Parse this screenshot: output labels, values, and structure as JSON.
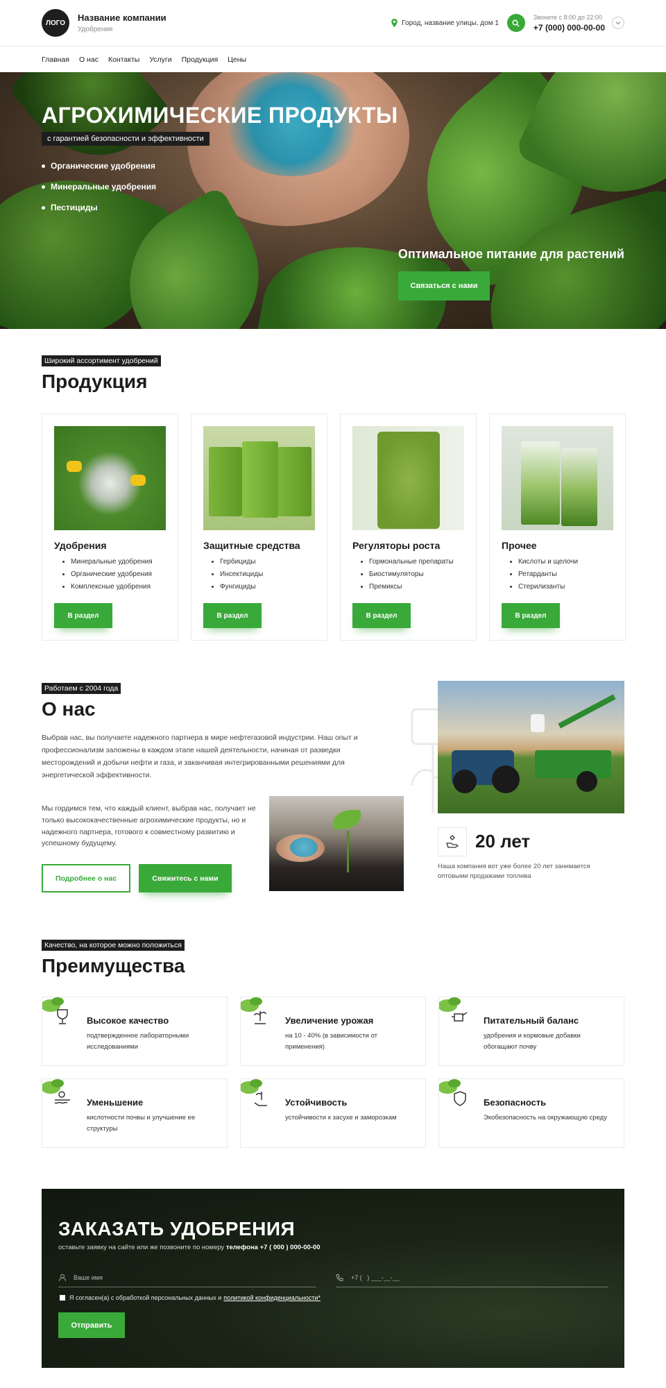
{
  "header": {
    "logo_text": "ЛОГО",
    "company_name": "Название компании",
    "company_sub": "Удобрения",
    "address": "Город, название улицы, дом 1",
    "hours": "Звоните с 8:00 до 22:00",
    "phone": "+7 (000) 000-00-00"
  },
  "nav": {
    "items": [
      "Главная",
      "О нас",
      "Контакты",
      "Услуги",
      "Продукция",
      "Цены"
    ]
  },
  "hero": {
    "title": "АГРОХИМИЧЕСКИЕ ПРОДУКТЫ",
    "subtitle": "с гарантией безопасности и эффективности",
    "list": [
      "Органические удобрения",
      "Минеральные удобрения",
      "Пестициды"
    ],
    "cta_text": "Оптимальное питание для растений",
    "cta_button": "Связаться с нами"
  },
  "products": {
    "tag": "Широкий ассортимент удобрений",
    "title": "Продукция",
    "button_label": "В раздел",
    "items": [
      {
        "name": "Удобрения",
        "list": [
          "Минеральные удобрения",
          "Органические удобрения",
          "Комплексные удобрения"
        ]
      },
      {
        "name": "Защитные средства",
        "list": [
          "Гербициды",
          "Инсектициды",
          "Фунгициды"
        ]
      },
      {
        "name": "Регуляторы роста",
        "list": [
          "Гормональные препараты",
          "Биостимуляторы",
          "Премиксы"
        ]
      },
      {
        "name": "Прочее",
        "list": [
          "Кислоты и щелочи",
          "Ретарданты",
          "Стерилизанты"
        ]
      }
    ]
  },
  "about": {
    "tag": "Работаем с 2004 года",
    "title": "О нас",
    "p1": "Выбрав нас, вы получаете надежного партнера в мире нефтегазовой индустрии. Наш опыт и профессионализм заложены в каждом этапе нашей деятельности, начиная от разведки месторождений и добычи нефти и газа, и заканчивая интегрированными решениями для энергетической эффективности.",
    "p2": "Мы гордимся тем, что каждый клиент, выбрав нас, получает не только высококачественные агрохимические продукты, но и надежного партнера, готового к совместному развитию и успешному будущему.",
    "btn_more": "Подробнее о нас",
    "btn_contact": "Свяжитесь с нами",
    "years": "20 лет",
    "years_text": "Наша компания вот уже более 20 лет занимается оптовыми продажами топлива"
  },
  "advantages": {
    "tag": "Качество, на которое можно положиться",
    "title": "Преимущества",
    "items": [
      {
        "title": "Высокое качество",
        "text": "подтвержденное лабораторными исследованиями",
        "icon": "trophy-icon"
      },
      {
        "title": "Увеличение урожая",
        "text": "на 10 - 40% (в зависимости от применения)",
        "icon": "sprout-hand-icon"
      },
      {
        "title": "Питательный баланс",
        "text": "удобрения и кормовые добавки обогащают почву",
        "icon": "watering-can-icon"
      },
      {
        "title": "Уменьшение",
        "text": "кислотности почвы и улучшение ее структуры",
        "icon": "soil-icon"
      },
      {
        "title": "Устойчивость",
        "text": "устойчивости к засухе и заморозкам",
        "icon": "plant-hand-icon"
      },
      {
        "title": "Безопасность",
        "text": "Экобезопасность на окружающую среду",
        "icon": "shield-leaf-icon"
      }
    ]
  },
  "order": {
    "title": "ЗАКАЗАТЬ УДОБРЕНИЯ",
    "sub_prefix": "оставьте заявку на сайте или же позвоните по номеру",
    "sub_phone": "телефона +7 ( 000 ) 000-00-00",
    "name_placeholder": "Ваше имя",
    "phone_placeholder": "+7 (   ) ___-__-__",
    "agree_text": "Я согласен(а) с обработкой персональных данных и",
    "agree_link": "политикой конфиденциальности*",
    "submit": "Отправить"
  },
  "colors": {
    "accent": "#39a93a",
    "dark": "#1e1e1e"
  }
}
